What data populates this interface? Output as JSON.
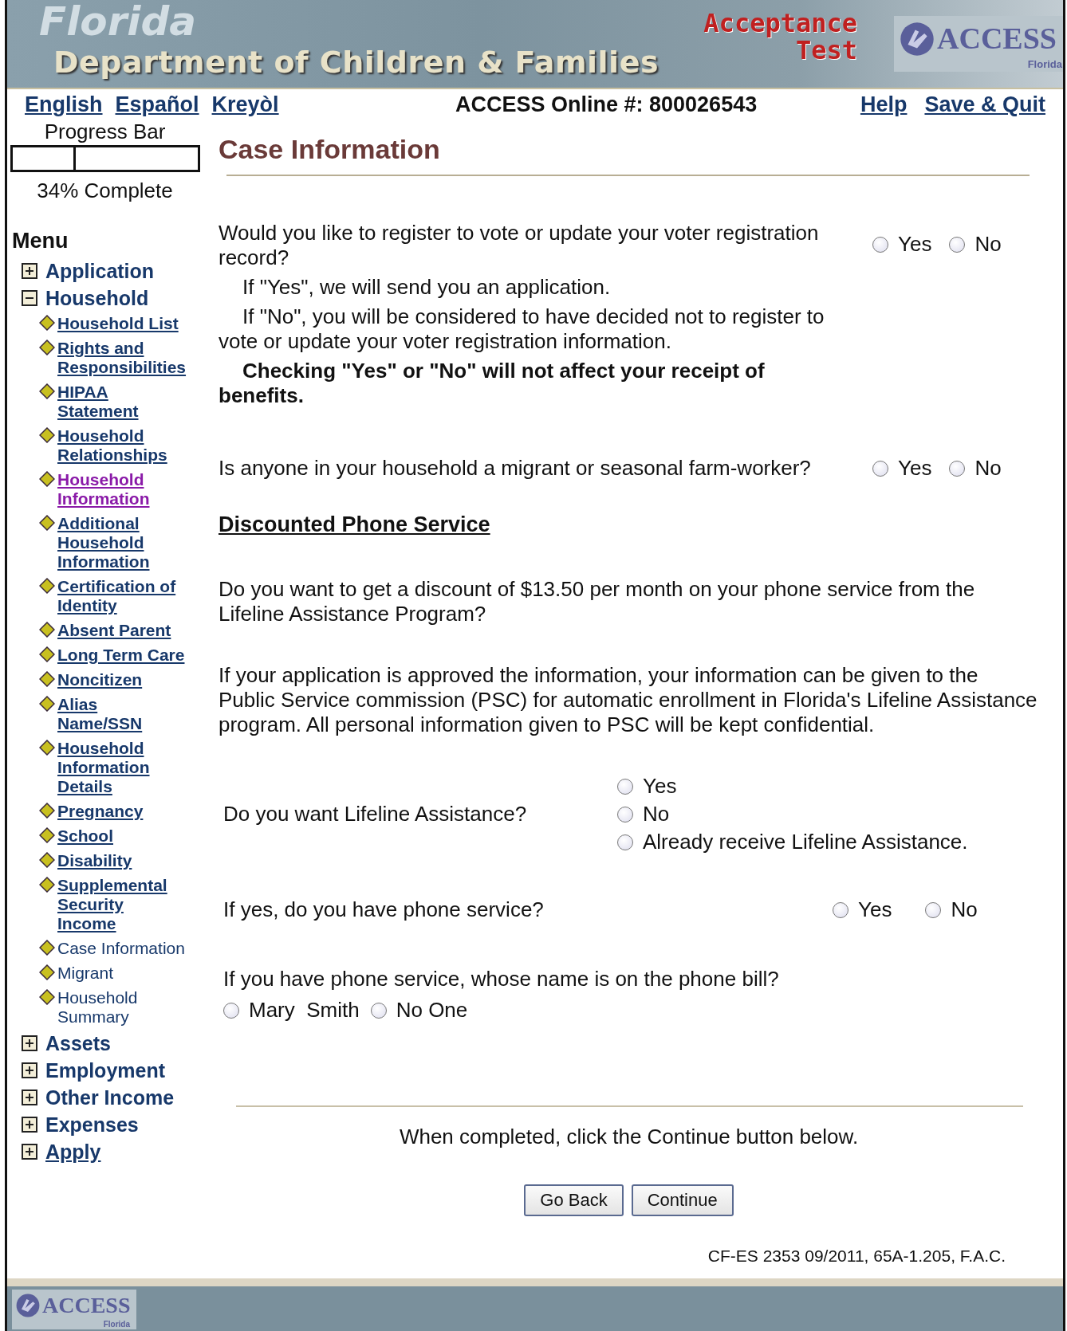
{
  "header": {
    "watermark": "Florida",
    "title": "Department of Children & Families",
    "stamp": [
      "Acceptance",
      "Test"
    ],
    "logo": {
      "word": "ACCESS",
      "state": "Florida"
    }
  },
  "top_bar": {
    "languages": [
      "English",
      "Español",
      "Kreyòl"
    ],
    "online_number": "ACCESS Online #: 800026543",
    "links": [
      "Help",
      "Save & Quit"
    ]
  },
  "progress": {
    "label": "Progress Bar",
    "level": 0.34,
    "caption": "34% Complete"
  },
  "menu": {
    "title": "Menu",
    "groups": [
      {
        "label": "Application",
        "kind": "heading",
        "expanded": false
      },
      {
        "label": "Household",
        "kind": "heading",
        "expanded": true,
        "children": [
          {
            "label": "Household List",
            "kind": "link"
          },
          {
            "label": "Rights and Responsibilities",
            "kind": "link"
          },
          {
            "label": "HIPAA Statement",
            "kind": "link"
          },
          {
            "label": "Household Relationships",
            "kind": "link"
          },
          {
            "label": "Household Information",
            "kind": "visited"
          },
          {
            "label": "Additional Household Information",
            "kind": "link"
          },
          {
            "label": "Certification of Identity",
            "kind": "link"
          },
          {
            "label": "Absent Parent",
            "kind": "link"
          },
          {
            "label": "Long Term Care",
            "kind": "link"
          },
          {
            "label": "Noncitizen",
            "kind": "link"
          },
          {
            "label": "Alias Name/SSN",
            "kind": "link"
          },
          {
            "label": "Household Information Details",
            "kind": "link"
          },
          {
            "label": "Pregnancy",
            "kind": "link"
          },
          {
            "label": "School",
            "kind": "link"
          },
          {
            "label": "Disability",
            "kind": "link"
          },
          {
            "label": "Supplemental Security Income",
            "kind": "link"
          },
          {
            "label": "Case Information",
            "kind": "text"
          },
          {
            "label": "Migrant",
            "kind": "text"
          },
          {
            "label": "Household Summary",
            "kind": "text"
          }
        ]
      },
      {
        "label": "Assets",
        "kind": "heading",
        "expanded": false
      },
      {
        "label": "Employment",
        "kind": "heading",
        "expanded": false
      },
      {
        "label": "Other Income",
        "kind": "heading",
        "expanded": false
      },
      {
        "label": "Expenses",
        "kind": "heading",
        "expanded": false
      },
      {
        "label": "Apply",
        "kind": "link",
        "expanded": false
      }
    ]
  },
  "page_title": "Case Information",
  "blocks": [
    {
      "kind": "question",
      "text": "Would you like to register to vote or update your voter registration record?",
      "notes": [
        {
          "text": "If \"Yes\", we will send you an application.",
          "bold": false
        },
        {
          "text": "If \"No\", you will be considered to have decided not to register to vote or update your voter registration information.",
          "bold": false
        },
        {
          "text": "Checking \"Yes\" or \"No\" will not affect your receipt of benefits.",
          "bold": true
        }
      ],
      "options": [
        {
          "label": "Yes",
          "selected": false
        },
        {
          "label": "No",
          "selected": false
        }
      ]
    },
    {
      "kind": "question",
      "text": "Is anyone in your household a migrant or seasonal farm-worker?",
      "options": [
        {
          "label": "Yes",
          "selected": false
        },
        {
          "label": "No",
          "selected": false
        }
      ]
    },
    {
      "kind": "heading",
      "text": "Discounted Phone Service"
    },
    {
      "kind": "paragraph",
      "text": "Do you want to get a discount of $13.50 per month on your phone service from the Lifeline Assistance Program?"
    },
    {
      "kind": "paragraph",
      "text": "If your application is approved the information, your information can be given to the Public Service commission (PSC) for automatic enrollment in Florida's Lifeline Assistance program. All personal information given to PSC will be kept confidential."
    },
    {
      "kind": "stacked",
      "text": "Do you want Lifeline Assistance?",
      "options": [
        {
          "label": "Yes",
          "selected": false
        },
        {
          "label": "No",
          "selected": false
        },
        {
          "label": "Already receive Lifeline Assistance.",
          "selected": false
        }
      ]
    },
    {
      "kind": "spaced",
      "text": "If yes, do you have phone service?",
      "options": [
        {
          "label": "Yes",
          "selected": false
        },
        {
          "label": "No",
          "selected": false
        }
      ]
    },
    {
      "kind": "below",
      "text": "If you have phone service, whose name is on the phone bill?",
      "options": [
        {
          "label": "Mary  Smith",
          "selected": false
        },
        {
          "label": "No One",
          "selected": false
        }
      ]
    }
  ],
  "instruction": "When completed, click the Continue button below.",
  "buttons": [
    "Go Back",
    "Continue"
  ],
  "form_code": "CF-ES 2353 09/2011, 65A-1.205, F.A.C.",
  "footer_logo": {
    "word": "ACCESS",
    "state": "Florida"
  }
}
